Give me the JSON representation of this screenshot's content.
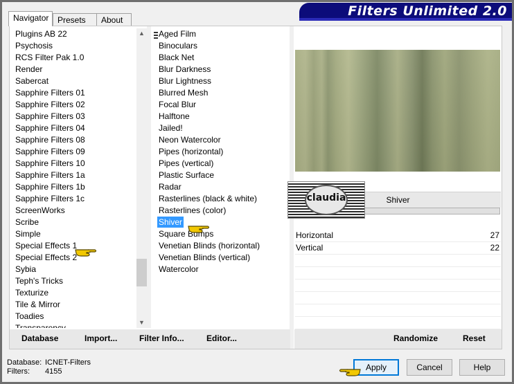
{
  "window": {
    "title": "Filters Unlimited 2.0"
  },
  "tabs": [
    {
      "label": "Navigator"
    },
    {
      "label": "Presets"
    },
    {
      "label": "About"
    }
  ],
  "categories": [
    "Plugins AB 22",
    "Psychosis",
    "RCS Filter Pak 1.0",
    "Render",
    "Sabercat",
    "Sapphire Filters 01",
    "Sapphire Filters 02",
    "Sapphire Filters 03",
    "Sapphire Filters 04",
    "Sapphire Filters 08",
    "Sapphire Filters 09",
    "Sapphire Filters 10",
    "Sapphire Filters 1a",
    "Sapphire Filters 1b",
    "Sapphire Filters 1c",
    "ScreenWorks",
    "Scribe",
    "Simple",
    "Special Effects 1",
    "Special Effects 2",
    "Sybia",
    "Teph's Tricks",
    "Texturize",
    "Tile & Mirror",
    "Toadies",
    "Transparency"
  ],
  "filters": [
    "Aged Film",
    "Binoculars",
    "Black Net",
    "Blur Darkness",
    "Blur Lightness",
    "Blurred Mesh",
    "Focal Blur",
    "Halftone",
    "Jailed!",
    "Neon Watercolor",
    "Pipes (horizontal)",
    "Pipes (vertical)",
    "Plastic Surface",
    "Radar",
    "Rasterlines (black & white)",
    "Rasterlines (color)",
    "Shiver",
    "Square Bumps",
    "Venetian Blinds (horizontal)",
    "Venetian Blinds (vertical)",
    "Watercolor"
  ],
  "selected_filter_name": "Shiver",
  "logo_text": "claudia",
  "params": [
    {
      "label": "Horizontal",
      "value": "27"
    },
    {
      "label": "Vertical",
      "value": "22"
    }
  ],
  "bottom_left_buttons": {
    "database": "Database",
    "import": "Import...",
    "filter_info": "Filter Info...",
    "editor": "Editor..."
  },
  "bottom_right_buttons": {
    "randomize": "Randomize",
    "reset": "Reset"
  },
  "status": {
    "db_label": "Database:",
    "db_value": "ICNET-Filters",
    "filters_label": "Filters:",
    "filters_value": "4155"
  },
  "dialog_buttons": {
    "apply": "Apply",
    "cancel": "Cancel",
    "help": "Help"
  },
  "colors": {
    "title_bg": "#0c0c7a",
    "selection": "#3399ff",
    "hand_pointer": "#f2c800"
  },
  "icons": [
    "hand-pointer-icon",
    "scroll-up-icon",
    "scroll-down-icon"
  ]
}
